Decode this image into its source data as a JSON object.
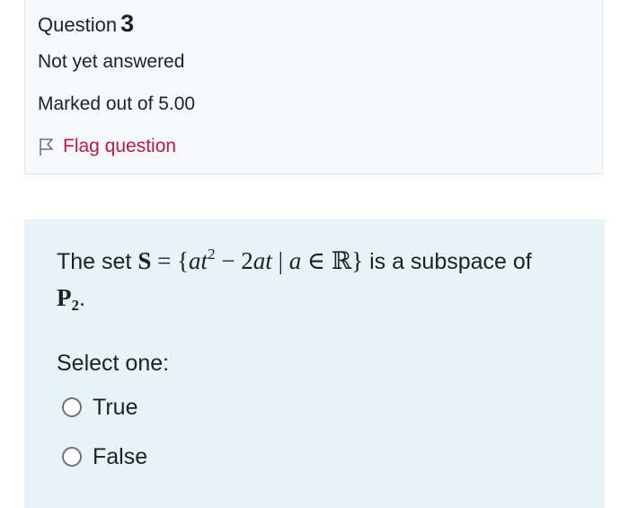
{
  "question_info": {
    "heading_word": "Question",
    "number": "3",
    "state": "Not yet answered",
    "grade": "Marked out of 5.00",
    "flag_label": "Flag question"
  },
  "question": {
    "text_intro": "The set",
    "math_set_symbol": "S",
    "math_eq": " = {",
    "math_a1": "at",
    "math_exp": "2",
    "math_minus": " − 2",
    "math_a2": "at",
    "math_bar": " | ",
    "math_a3": "a",
    "math_in": " ∈ ℝ}",
    "text_mid": "is a subspace of",
    "math_space": "P",
    "math_sub": "2",
    "text_end": ".",
    "select_label": "Select one:",
    "options": [
      {
        "label": "True",
        "selected": false
      },
      {
        "label": "False",
        "selected": false
      }
    ]
  },
  "colors": {
    "flag": "#c1173f",
    "info_bg": "#f8f9fa",
    "content_bg": "#e7f3f5"
  }
}
